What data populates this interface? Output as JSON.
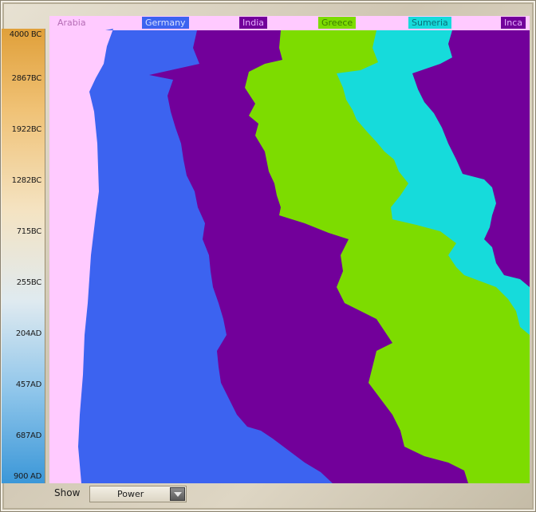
{
  "timeline": {
    "labels": [
      "4000 BC",
      "2867BC",
      "1922BC",
      "1282BC",
      "715BC",
      "255BC",
      "204AD",
      "457AD",
      "687AD",
      "900 AD"
    ]
  },
  "civilizations": [
    {
      "name": "Arabia",
      "color": "#ffcaff",
      "label_bg": "#ffcaff",
      "label_color": "#b56db5"
    },
    {
      "name": "Germany",
      "color": "#3c63f0",
      "label_bg": "#3c63f0",
      "label_color": "#d7e0ff"
    },
    {
      "name": "India",
      "color": "#72009a",
      "label_bg": "#72009a",
      "label_color": "#e6b3ff"
    },
    {
      "name": "Greece",
      "color": "#7ddc00",
      "label_bg": "#7ddc00",
      "label_color": "#3b7a00"
    },
    {
      "name": "Sumeria",
      "color": "#16dbdb",
      "label_bg": "#16dbdb",
      "label_color": "#0b6f7a"
    },
    {
      "name": "Inca",
      "color": "#72009a",
      "label_bg": "#72009a",
      "label_color": "#e6b3ff"
    }
  ],
  "bottom": {
    "show_label": "Show",
    "selected": "Power"
  }
}
